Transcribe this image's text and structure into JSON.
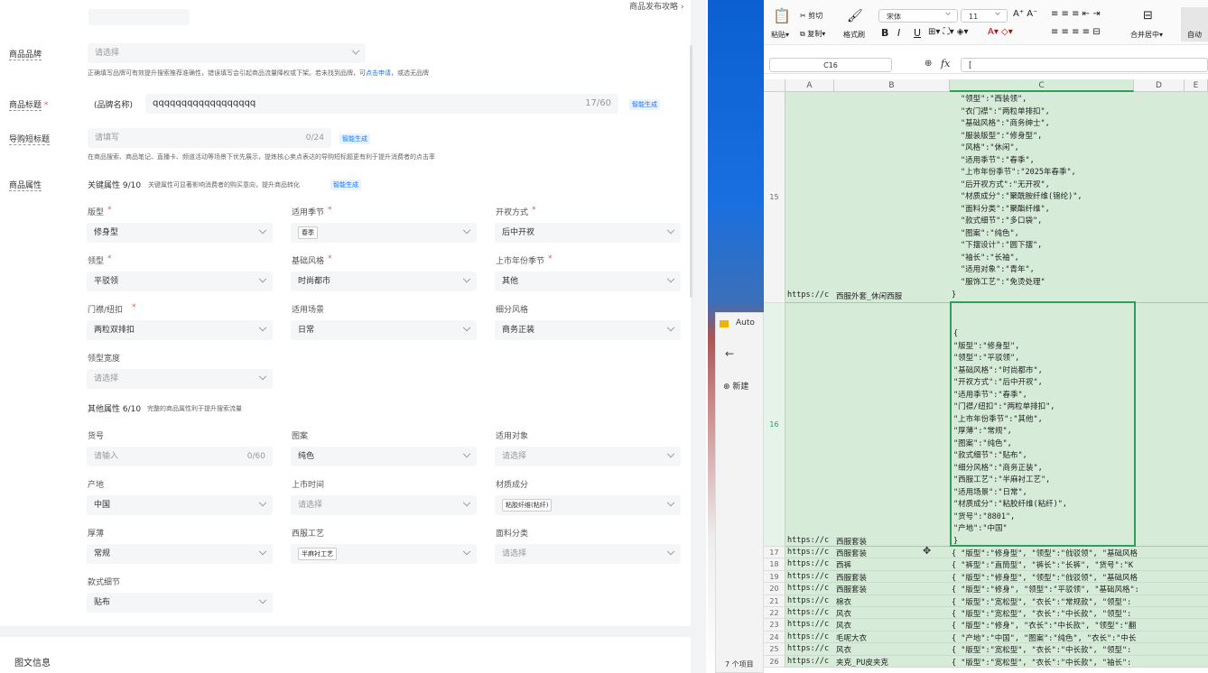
{
  "left": {
    "top_link": "商品发布攻略 ›",
    "brand": {
      "label": "商品品牌",
      "placeholder": "请选择",
      "hint_pre": "正确填写品牌可有效提升搜索推荐准确性，错误填写会引起商品流量降权或下架。若未找到品牌，可",
      "hint_link": "点击申请",
      "hint_post": "，或选无品牌"
    },
    "title": {
      "label": "商品标题",
      "prefix": "(品牌名称)",
      "value": "qqqqqqqqqqqqqqqqqq",
      "counter": "17/60",
      "ai": "智能生成"
    },
    "guide": {
      "label": "导购短标题",
      "placeholder": "请填写",
      "counter": "0/24",
      "ai": "智能生成",
      "hint": "在商品搜索、商品笔记、直播卡、频道活动等场景下优先展示，提炼核心卖点表达的导购短标题更有利于提升消费者的点击率"
    },
    "attrs": {
      "label": "商品属性",
      "key_title": "关键属性 9/10",
      "key_hint": "关键属性可显著影响消费者的购买意向，提升商品转化",
      "ai": "智能生成"
    },
    "fields": [
      {
        "label": "版型",
        "req": true,
        "value": "修身型"
      },
      {
        "label": "适用季节",
        "req": true,
        "tag": "春季"
      },
      {
        "label": "开衩方式",
        "req": true,
        "value": "后中开衩"
      },
      {
        "label": "领型",
        "req": true,
        "value": "平驳领"
      },
      {
        "label": "基础风格",
        "req": true,
        "value": "时尚都市"
      },
      {
        "label": "上市年份季节",
        "req": true,
        "value": "其他"
      },
      {
        "label": "门襟/纽扣",
        "req": true,
        "value": "两粒双排扣"
      },
      {
        "label": "适用场景",
        "req": false,
        "value": "日常"
      },
      {
        "label": "细分风格",
        "req": false,
        "value": "商务正装"
      },
      {
        "label": "领型宽度",
        "req": false,
        "placeholder": "请选择"
      }
    ],
    "other_title": "其他属性 6/10",
    "other_hint": "完整的商品属性利于提升搜索流量",
    "other_fields": [
      {
        "label": "货号",
        "placeholder": "请输入",
        "counter": "0/60"
      },
      {
        "label": "图案",
        "value": "纯色"
      },
      {
        "label": "适用对象",
        "placeholder": "请选择"
      },
      {
        "label": "产地",
        "value": "中国"
      },
      {
        "label": "上市时间",
        "placeholder": "请选择"
      },
      {
        "label": "材质成分",
        "tag": "粘胶纤维(粘纤)"
      },
      {
        "label": "厚薄",
        "value": "常规"
      },
      {
        "label": "西服工艺",
        "tag": "半麻衬工艺"
      },
      {
        "label": "面料分类",
        "placeholder": "请选择"
      },
      {
        "label": "款式细节",
        "value": "贴布"
      }
    ],
    "section2": "图文信息"
  },
  "wps": {
    "paste": "粘贴",
    "cut": "剪切",
    "copy": "复制",
    "format_painter": "格式刷",
    "font": "宋体",
    "size": "11",
    "merge": "合并居中",
    "auto": "自动",
    "cellref": "C16",
    "fx": "fx",
    "formula": "[",
    "cols": [
      "A",
      "B",
      "C",
      "D",
      "E"
    ],
    "row15_lines": [
      "\"领型\":\"西装领\",",
      "\"衣门襟\":\"两粒单排扣\",",
      "\"基础风格\":\"商务绅士\",",
      "\"服装版型\":\"修身型\",",
      "\"风格\":\"休闲\",",
      "\"适用季节\":\"春季\",",
      "\"上市年份季节\":\"2025年春季\",",
      "\"后开衩方式\":\"无开衩\",",
      "\"材质成分\":\"聚酰胺纤维(锦纶)\",",
      "\"面料分类\":\"聚酯纤维\",",
      "\"款式细节\":\"多口袋\",",
      "\"图案\":\"纯色\",",
      "\"下摆设计\":\"圆下摆\",",
      "\"袖长\":\"长袖\",",
      "\"适用对象\":\"青年\",",
      "\"服饰工艺\":\"免烫处理\""
    ],
    "row15_a": "https://c",
    "row15_b": "西服外套_休闲西服",
    "row15_close": "}",
    "row16_lines": [
      "{",
      "\"版型\":\"修身型\",",
      "\"领型\":\"平驳领\",",
      "\"基础风格\":\"时尚都市\",",
      "\"开衩方式\":\"后中开衩\",",
      "\"适用季节\":\"春季\",",
      "\"门襟/纽扣\":\"两粒单排扣\",",
      "\"上市年份季节\":\"其他\",",
      "\"厚薄\":\"常规\",",
      "\"图案\":\"纯色\",",
      "\"款式细节\":\"贴布\",",
      "\"细分风格\":\"商务正装\",",
      "\"西服工艺\":\"半麻衬工艺\",",
      "\"适用场景\":\"日常\",",
      "\"材质成分\":\"粘胶纤维(粘纤)\",",
      "\"货号\":\"8801\",",
      "\"产地\":\"中国\"",
      "}"
    ],
    "row16_a": "https://c",
    "row16_b": "西服套装",
    "rows": [
      {
        "n": "17",
        "a": "https://c",
        "b": "西服套装",
        "c": "{ \"版型\":\"修身型\", \"领型\":\"戗驳领\", \"基础风格"
      },
      {
        "n": "18",
        "a": "https://c",
        "b": "西裤",
        "c": "{ \"裤型\":\"直筒型\", \"裤长\":\"长裤\", \"货号\":\"K"
      },
      {
        "n": "19",
        "a": "https://c",
        "b": "西服套装",
        "c": "{ \"版型\":\"修身型\", \"领型\":\"戗驳领\", \"基础风格"
      },
      {
        "n": "20",
        "a": "https://c",
        "b": "西服套装",
        "c": "{ \"版型\":\"修身\", \"领型\":\"平驳领\", \"基础风格\":"
      },
      {
        "n": "21",
        "a": "https://c",
        "b": "棉衣",
        "c": "{ \"版型\":\"宽松型\", \"衣长\":\"常规款\", \"领型\":"
      },
      {
        "n": "22",
        "a": "https://c",
        "b": "风衣",
        "c": "{ \"版型\":\"宽松型\", \"衣长\":\"中长款\", \"领型\":"
      },
      {
        "n": "23",
        "a": "https://c",
        "b": "风衣",
        "c": "{ \"版型\":\"修身\", \"衣长\":\"中长款\", \"领型\":\"翻"
      },
      {
        "n": "24",
        "a": "https://c",
        "b": "毛呢大衣",
        "c": "{ \"产地\":\"中国\", \"图案\":\"纯色\", \"衣长\":\"中长"
      },
      {
        "n": "25",
        "a": "https://c",
        "b": "风衣",
        "c": "{ \"版型\":\"宽松型\", \"衣长\":\"中长款\", \"领型\":"
      },
      {
        "n": "26",
        "a": "https://c",
        "b": "夹克_PU皮夹克",
        "c": "{ \"版型\":\"宽松型\", \"衣长\":\"中长款\", \"袖长\":"
      }
    ]
  },
  "explorer": {
    "title": "Auto",
    "new": "新建",
    "footer": "7 个项目"
  }
}
